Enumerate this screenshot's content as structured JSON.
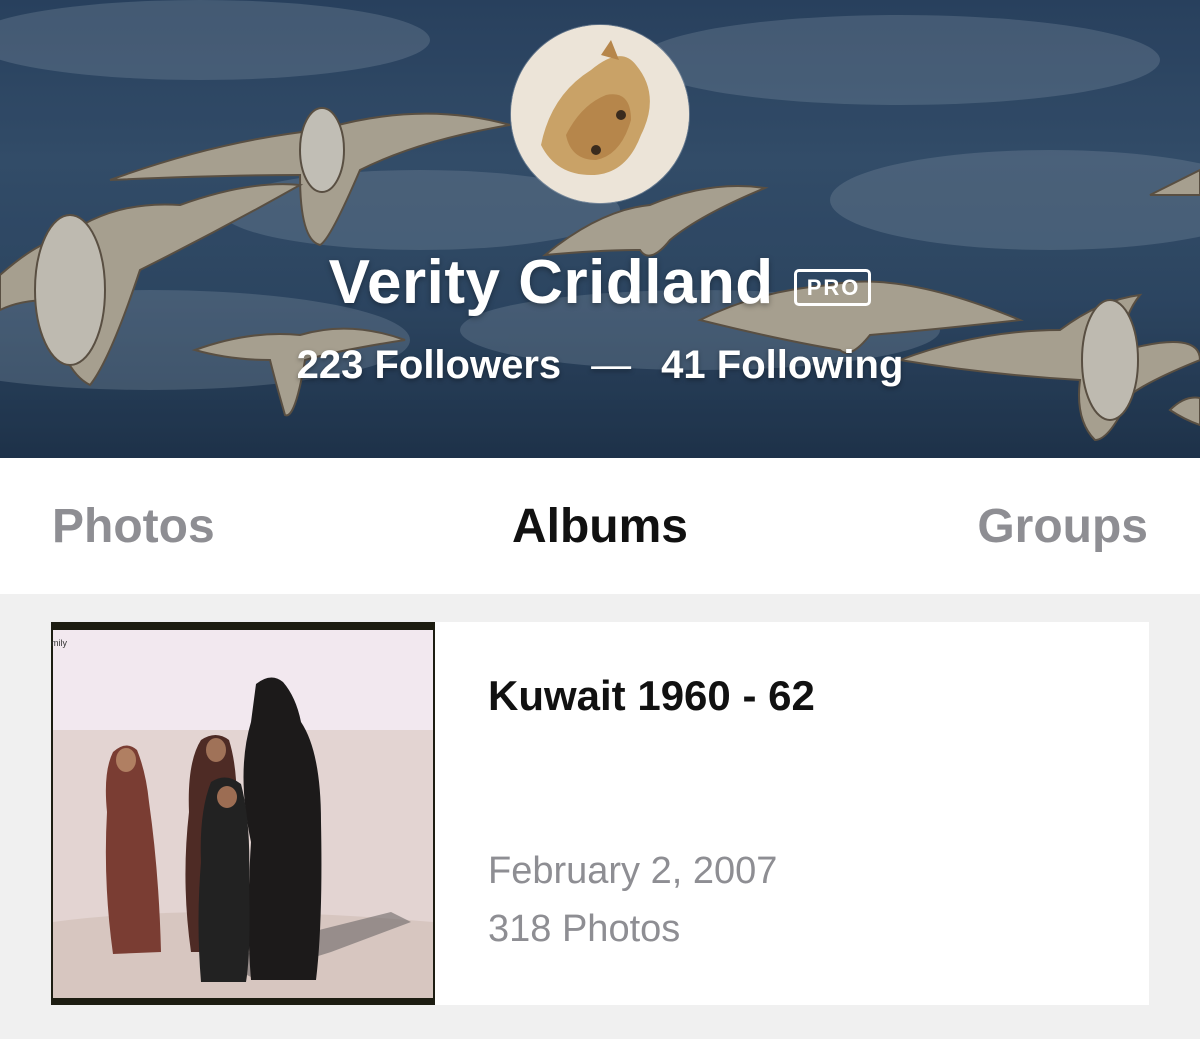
{
  "profile": {
    "name": "Verity Cridland",
    "badge": "PRO",
    "followers": "223 Followers",
    "separator": "—",
    "following": "41 Following"
  },
  "tabs": [
    {
      "label": "Photos",
      "active": false
    },
    {
      "label": "Albums",
      "active": true
    },
    {
      "label": "Groups",
      "active": false
    }
  ],
  "albums": [
    {
      "title": "Kuwait 1960 - 62",
      "date": "February 2, 2007",
      "count": "318 Photos",
      "thumb_caption": "mily"
    }
  ],
  "colors": {
    "active_tab": "#111111",
    "inactive_tab": "#8e8e93",
    "meta_text": "#8e8e93",
    "background": "#f0f0f0"
  }
}
